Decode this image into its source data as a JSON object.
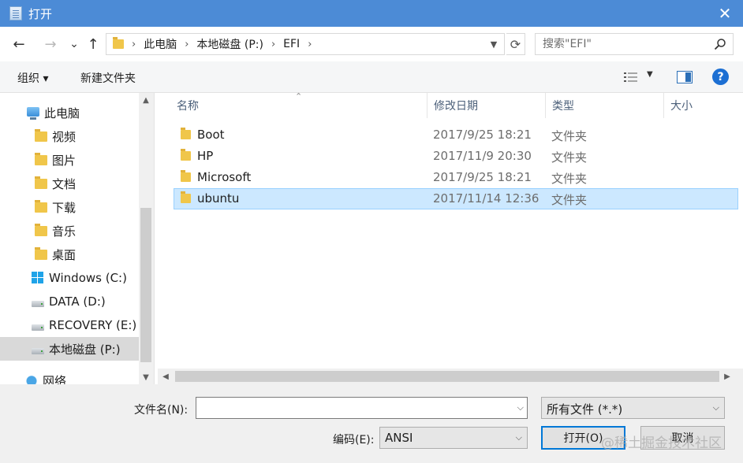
{
  "window": {
    "title": "打开",
    "close_label": "✕"
  },
  "nav": {
    "back_label": "←",
    "forward_label": "→",
    "recent_label": "⌄",
    "up_label": "↑",
    "breadcrumb": [
      "此电脑",
      "本地磁盘 (P:)",
      "EFI"
    ],
    "refresh_label": "⟳",
    "search_placeholder": "搜索\"EFI\""
  },
  "toolbar": {
    "organize_label": "组织 ▾",
    "new_folder_label": "新建文件夹",
    "help_label": "?"
  },
  "sidebar": {
    "items": [
      {
        "label": "此电脑",
        "icon": "computer-icon"
      },
      {
        "label": "视频",
        "icon": "videos-folder-icon"
      },
      {
        "label": "图片",
        "icon": "pictures-folder-icon"
      },
      {
        "label": "文档",
        "icon": "documents-folder-icon"
      },
      {
        "label": "下载",
        "icon": "downloads-folder-icon"
      },
      {
        "label": "音乐",
        "icon": "music-folder-icon"
      },
      {
        "label": "桌面",
        "icon": "desktop-folder-icon"
      },
      {
        "label": "Windows (C:)",
        "icon": "windows-drive-icon"
      },
      {
        "label": "DATA (D:)",
        "icon": "drive-icon"
      },
      {
        "label": "RECOVERY (E:)",
        "icon": "drive-icon"
      },
      {
        "label": "本地磁盘 (P:)",
        "icon": "drive-icon",
        "selected": true
      },
      {
        "label": "网络",
        "icon": "network-icon"
      }
    ]
  },
  "filelist": {
    "columns": [
      "名称",
      "修改日期",
      "类型",
      "大小"
    ],
    "rows": [
      {
        "name": "Boot",
        "date": "2017/9/25 18:21",
        "type": "文件夹",
        "size": ""
      },
      {
        "name": "HP",
        "date": "2017/11/9 20:30",
        "type": "文件夹",
        "size": ""
      },
      {
        "name": "Microsoft",
        "date": "2017/9/25 18:21",
        "type": "文件夹",
        "size": ""
      },
      {
        "name": "ubuntu",
        "date": "2017/11/14 12:36",
        "type": "文件夹",
        "size": "",
        "selected": true
      }
    ]
  },
  "bottom": {
    "filename_label": "文件名(N):",
    "filename_value": "",
    "filetype_value": "所有文件  (*.*)",
    "encoding_label": "编码(E):",
    "encoding_value": "ANSI",
    "open_label": "打开(O)",
    "cancel_label": "取消"
  },
  "watermark": "@稀土掘金技术社区",
  "colors": {
    "titlebar": "#4c8bd6",
    "selection": "#cce8ff",
    "accent": "#0078d7",
    "folder": "#f0c64a"
  }
}
